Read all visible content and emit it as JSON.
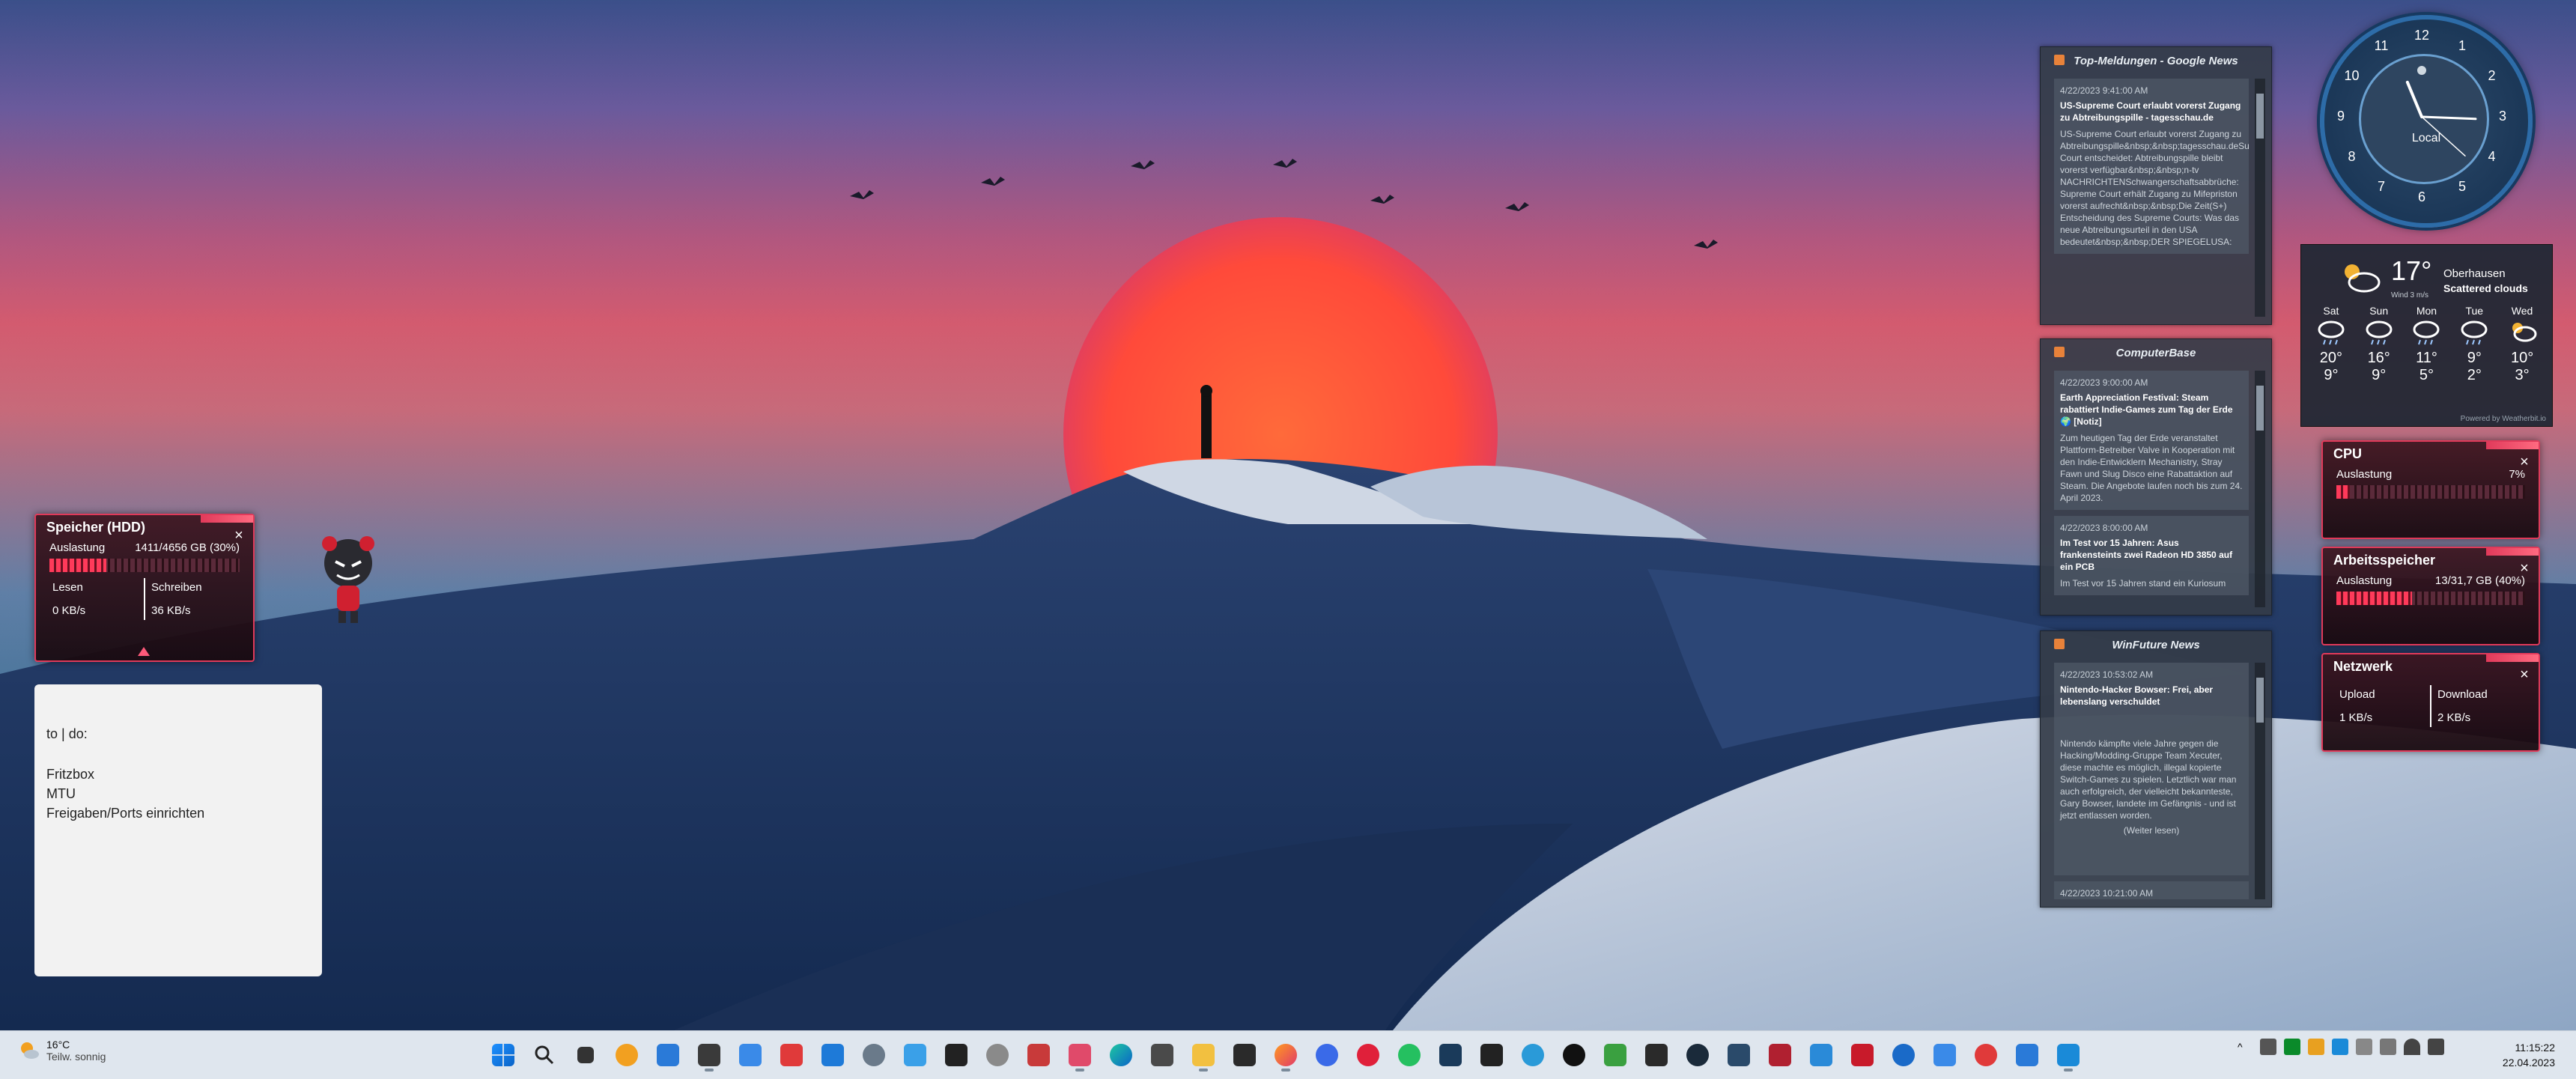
{
  "hdd": {
    "title": "Speicher (HDD)",
    "usage_label": "Auslastung",
    "usage_value": "1411/4656 GB (30%)",
    "usage_fraction": 0.3,
    "read_label": "Lesen",
    "read_value": "0 KB/s",
    "write_label": "Schreiben",
    "write_value": "36 KB/s",
    "close": "×",
    "warning_icon": "warning-triangle-icon"
  },
  "sticky": {
    "lines": [
      "to | do:",
      "",
      "Fritzbox",
      "MTU",
      "Freigaben/Ports einrichten"
    ]
  },
  "rss": [
    {
      "title": "Top-Meldungen - Google News",
      "items": [
        {
          "date": "4/22/2023 9:41:00 AM",
          "headline": "US-Supreme Court erlaubt vorerst Zugang zu Abtreibungspille - tagesschau.de",
          "summary": "US-Supreme Court erlaubt vorerst Zugang zu Abtreibungspille&nbsp;&nbsp;tagesschau.deSupreme Court entscheidet: Abtreibungspille bleibt vorerst verfügbar&nbsp;&nbsp;n-tv NACHRICHTENSchwangerschaftsabbrüche: Supreme Court erhält Zugang zu Mifepriston vorerst aufrecht&nbsp;&nbsp;Die Zeit(S+) Entscheidung des Supreme Courts: Was das neue Abtreibungsurteil in den USA bedeutet&nbsp;&nbsp;DER SPIEGELUSA:"
        }
      ]
    },
    {
      "title": "ComputerBase",
      "items": [
        {
          "date": "4/22/2023 9:00:00 AM",
          "headline": "Earth Appreciation Festival: Steam rabattiert Indie-Games zum Tag der Erde 🌍 [Notiz]",
          "summary": "Zum heutigen Tag der Erde veranstaltet Plattform-Betreiber Valve in Kooperation mit den Indie-Entwicklern Mechanistry, Stray Fawn und Slug Disco eine Rabattaktion auf Steam. Die Angebote laufen noch bis zum 24. April 2023."
        },
        {
          "date": "4/22/2023 8:00:00 AM",
          "headline": "Im Test vor 15 Jahren: Asus frankensteints zwei Radeon HD 3850 auf ein PCB",
          "summary": "Im Test vor 15 Jahren stand ein Kuriosum"
        }
      ]
    },
    {
      "title": "WinFuture News",
      "items": [
        {
          "date": "4/22/2023 10:53:02 AM",
          "headline": "Nintendo-Hacker Bowser: Frei, aber lebenslang verschuldet",
          "summary": "Nintendo kämpfte viele Jahre gegen die Hacking/Modding-Gruppe Team Xecuter, diese machte es möglich, illegal kopierte Switch-Games zu spielen. Letztlich war man auch erfolgreich, der vielleicht bekannteste, Gary Bowser, landete im Gefängnis - und ist jetzt entlassen worden.",
          "more": "(Weiter lesen)"
        },
        {
          "date": "4/22/2023 10:21:00 AM",
          "headline": "",
          "summary": ""
        }
      ]
    }
  ],
  "clock": {
    "numbers": [
      "12",
      "1",
      "2",
      "3",
      "4",
      "5",
      "6",
      "7",
      "8",
      "9",
      "10",
      "11"
    ],
    "label": "Local",
    "hour": 11,
    "minute": 15,
    "second": 22
  },
  "weather": {
    "temp": "17°",
    "wind": "Wind 3 m/s",
    "city": "Oberhausen",
    "condition": "Scattered clouds",
    "credit": "Powered by Weatherbit.io",
    "days": [
      {
        "name": "Sat",
        "hi": "20°",
        "lo": "9°",
        "icon": "rain-cloud-icon"
      },
      {
        "name": "Sun",
        "hi": "16°",
        "lo": "9°",
        "icon": "rain-cloud-icon"
      },
      {
        "name": "Mon",
        "hi": "11°",
        "lo": "5°",
        "icon": "rain-cloud-icon"
      },
      {
        "name": "Tue",
        "hi": "9°",
        "lo": "2°",
        "icon": "rain-cloud-icon"
      },
      {
        "name": "Wed",
        "hi": "10°",
        "lo": "3°",
        "icon": "sun-cloud-icon"
      }
    ]
  },
  "cpu": {
    "title": "CPU",
    "usage_label": "Auslastung",
    "usage_value": "7%",
    "usage_fraction": 0.07,
    "close": "×"
  },
  "ram": {
    "title": "Arbeitsspeicher",
    "usage_label": "Auslastung",
    "usage_value": "13/31,7 GB (40%)",
    "usage_fraction": 0.4,
    "close": "×"
  },
  "net": {
    "title": "Netzwerk",
    "upload_label": "Upload",
    "upload_value": "1 KB/s",
    "download_label": "Download",
    "download_value": "2 KB/s",
    "close": "×"
  },
  "taskbar": {
    "weather_temp": "16°C",
    "weather_desc": "Teilw. sonnig",
    "time": "11:15:22",
    "date": "22.04.2023",
    "colors": {
      "background": "#dfe6ee",
      "accent": "#0a64c8"
    }
  }
}
